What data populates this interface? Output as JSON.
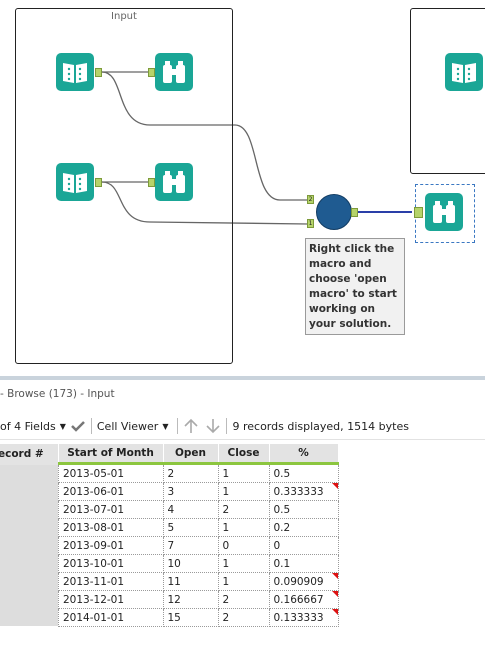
{
  "canvas": {
    "container_title": "Input",
    "comment": "Right click the macro and choose 'open macro' to start working on your solution.",
    "macro_anchor_1": "1",
    "macro_anchor_2": "2"
  },
  "results": {
    "title": "- Browse (173) - Input",
    "fields_label": "of 4 Fields",
    "viewer_label": "Cell Viewer",
    "status": "9 records displayed, 1514 bytes",
    "record_header": "ecord #",
    "columns": [
      "Start of Month",
      "Open",
      "Close",
      "%"
    ],
    "rows": [
      [
        "2013-05-01",
        "2",
        "1",
        "0.5"
      ],
      [
        "2013-06-01",
        "3",
        "1",
        "0.333333"
      ],
      [
        "2013-07-01",
        "4",
        "2",
        "0.5"
      ],
      [
        "2013-08-01",
        "5",
        "1",
        "0.2"
      ],
      [
        "2013-09-01",
        "7",
        "0",
        "0"
      ],
      [
        "2013-10-01",
        "10",
        "1",
        "0.1"
      ],
      [
        "2013-11-01",
        "11",
        "1",
        "0.090909"
      ],
      [
        "2013-12-01",
        "12",
        "2",
        "0.166667"
      ],
      [
        "2014-01-01",
        "15",
        "2",
        "0.133333"
      ]
    ],
    "flagged_rows": [
      1,
      6,
      7,
      8
    ]
  },
  "colors": {
    "tool_teal": "#1aa696",
    "macro_blue": "#1f5b91",
    "anchor_green": "#b5d36a",
    "header_underline": "#8cc63f"
  }
}
